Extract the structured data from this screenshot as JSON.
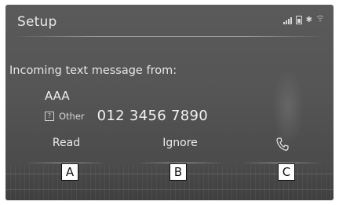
{
  "header": {
    "title": "Setup",
    "status_icons": [
      "signal-icon",
      "battery-icon",
      "bluetooth-icon",
      "wifi-icon"
    ]
  },
  "message": {
    "from_label": "Incoming text message from:",
    "sender_name": "AAA",
    "number_type_icon": "?",
    "number_type_label": "Other",
    "phone_number": "012 3456 7890"
  },
  "actions": {
    "read_label": "Read",
    "ignore_label": "Ignore",
    "call_icon": "phone-icon"
  },
  "callouts": {
    "a": "A",
    "b": "B",
    "c": "C"
  },
  "colors": {
    "screen_bg": "#555555",
    "text": "#ececec",
    "callout_bg": "#ffffff",
    "callout_border": "#111111"
  }
}
